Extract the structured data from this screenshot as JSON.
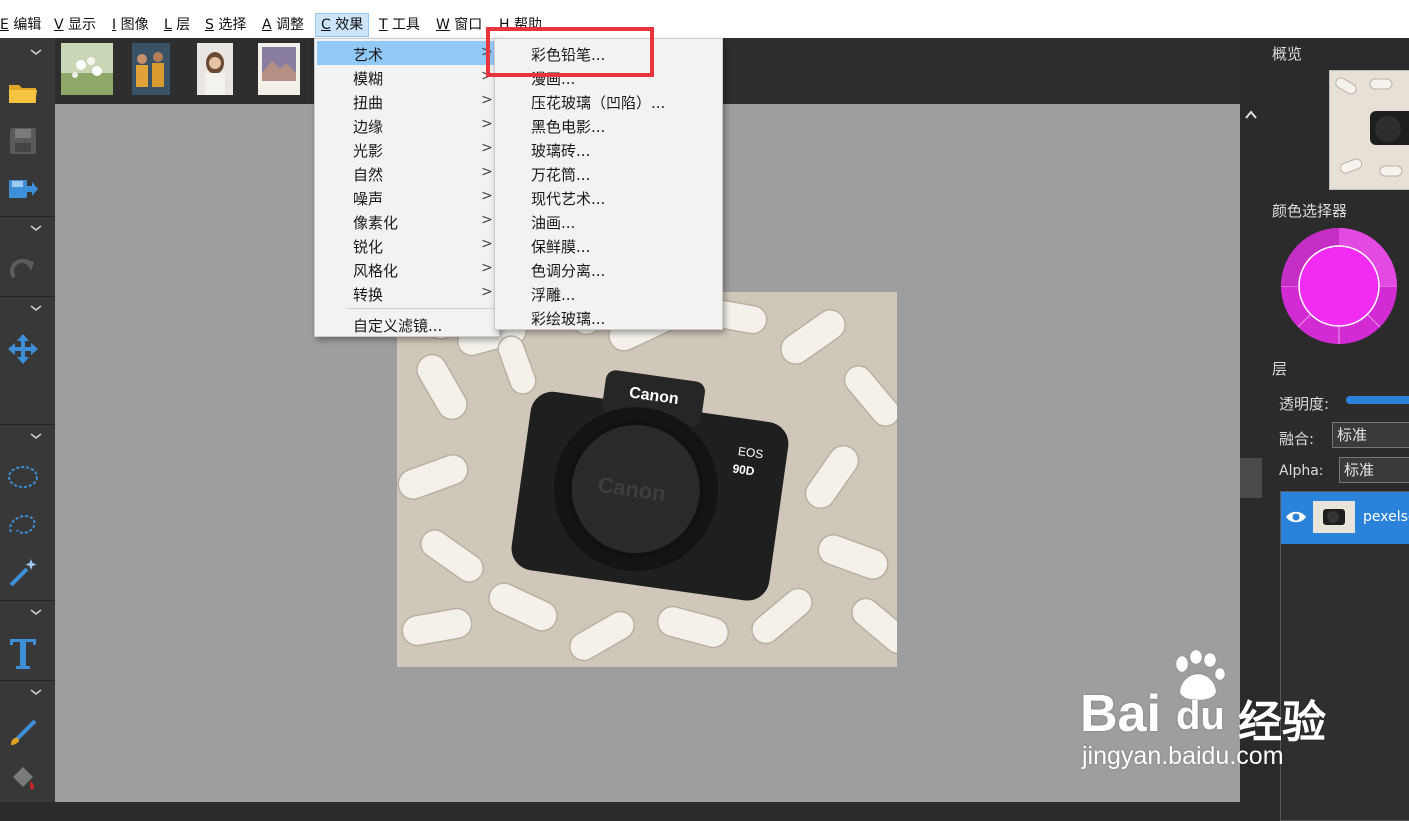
{
  "menubar": {
    "items": [
      {
        "key": "E",
        "label": "编辑"
      },
      {
        "key": "V",
        "label": "显示"
      },
      {
        "key": "I",
        "label": "图像"
      },
      {
        "key": "L",
        "label": "层"
      },
      {
        "key": "S",
        "label": "选择"
      },
      {
        "key": "A",
        "label": "调整"
      },
      {
        "key": "C",
        "label": "效果"
      },
      {
        "key": "T",
        "label": "工具"
      },
      {
        "key": "W",
        "label": "窗口"
      },
      {
        "key": "H",
        "label": "帮助"
      }
    ]
  },
  "effects_menu": {
    "items": [
      {
        "label": "艺术",
        "arrow": ">"
      },
      {
        "label": "模糊",
        "arrow": ">"
      },
      {
        "label": "扭曲",
        "arrow": ">"
      },
      {
        "label": "边缘",
        "arrow": ">"
      },
      {
        "label": "光影",
        "arrow": ">"
      },
      {
        "label": "自然",
        "arrow": ">"
      },
      {
        "label": "噪声",
        "arrow": ">"
      },
      {
        "label": "像素化",
        "arrow": ">"
      },
      {
        "label": "锐化",
        "arrow": ">"
      },
      {
        "label": "风格化",
        "arrow": ">"
      },
      {
        "label": "转换",
        "arrow": ">"
      }
    ],
    "custom_filter": "自定义滤镜..."
  },
  "art_submenu": {
    "items": [
      "彩色铅笔...",
      "漫画...",
      "压花玻璃（凹陷）...",
      "黑色电影...",
      "玻璃砖...",
      "万花筒...",
      "现代艺术...",
      "油画...",
      "保鲜膜...",
      "色调分离...",
      "浮雕...",
      "彩绘玻璃..."
    ]
  },
  "right_panel": {
    "overview_title": "概览",
    "color_picker_title": "颜色选择器",
    "layers_title": "层",
    "opacity_label": "透明度:",
    "blend_label": "融合:",
    "blend_value": "标准",
    "alpha_label": "Alpha:",
    "alpha_value": "标准",
    "layer_name": "pexels-"
  },
  "photo": {
    "brand": "Canon",
    "model_line1": "EOS",
    "model_line2": "90D",
    "cap_text": "Canon"
  },
  "watermark": {
    "brand_a": "Bai",
    "brand_b": "du",
    "brand_c": "经验",
    "url": "jingyan.baidu.com"
  },
  "colors": {
    "accent": "#2a82da",
    "menu_highlight": "#91c9f7",
    "annotation_box": "#e8343a",
    "color_wheel_center": "#f22cf2"
  }
}
